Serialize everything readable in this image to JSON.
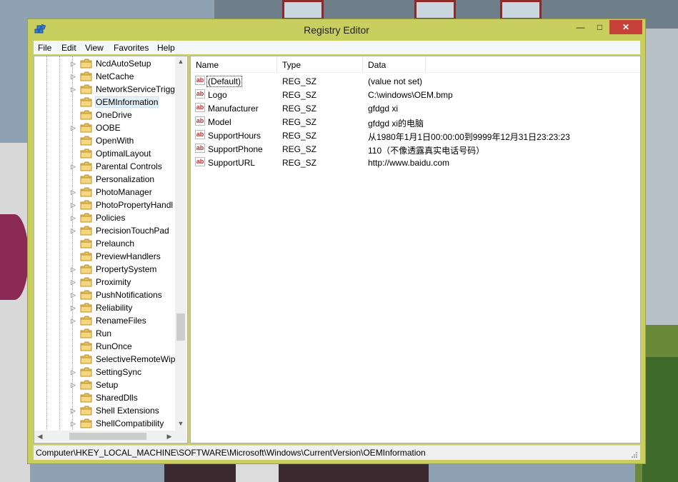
{
  "window": {
    "title": "Registry Editor",
    "minimize": "—",
    "maximize": "□",
    "close": "✕"
  },
  "menu": [
    "File",
    "Edit",
    "View",
    "Favorites",
    "Help"
  ],
  "tree": {
    "items": [
      {
        "label": "NcdAutoSetup",
        "expandable": true
      },
      {
        "label": "NetCache",
        "expandable": true
      },
      {
        "label": "NetworkServiceTrigg",
        "expandable": true
      },
      {
        "label": "OEMInformation",
        "expandable": false,
        "selected": true
      },
      {
        "label": "OneDrive",
        "expandable": false
      },
      {
        "label": "OOBE",
        "expandable": true
      },
      {
        "label": "OpenWith",
        "expandable": false
      },
      {
        "label": "OptimalLayout",
        "expandable": false
      },
      {
        "label": "Parental Controls",
        "expandable": true
      },
      {
        "label": "Personalization",
        "expandable": false
      },
      {
        "label": "PhotoManager",
        "expandable": true
      },
      {
        "label": "PhotoPropertyHandl",
        "expandable": true
      },
      {
        "label": "Policies",
        "expandable": true
      },
      {
        "label": "PrecisionTouchPad",
        "expandable": true
      },
      {
        "label": "Prelaunch",
        "expandable": false
      },
      {
        "label": "PreviewHandlers",
        "expandable": false
      },
      {
        "label": "PropertySystem",
        "expandable": true
      },
      {
        "label": "Proximity",
        "expandable": true
      },
      {
        "label": "PushNotifications",
        "expandable": true
      },
      {
        "label": "Reliability",
        "expandable": true
      },
      {
        "label": "RenameFiles",
        "expandable": true
      },
      {
        "label": "Run",
        "expandable": false
      },
      {
        "label": "RunOnce",
        "expandable": false
      },
      {
        "label": "SelectiveRemoteWipe",
        "expandable": false
      },
      {
        "label": "SettingSync",
        "expandable": true
      },
      {
        "label": "Setup",
        "expandable": true
      },
      {
        "label": "SharedDlls",
        "expandable": false
      },
      {
        "label": "Shell Extensions",
        "expandable": true
      },
      {
        "label": "ShellCompatibility",
        "expandable": true
      }
    ],
    "scroll_up": "▲",
    "scroll_down": "▼",
    "scroll_left": "◀",
    "scroll_right": "▶"
  },
  "list": {
    "columns": [
      "Name",
      "Type",
      "Data"
    ],
    "rows": [
      {
        "name": "(Default)",
        "type": "REG_SZ",
        "data": "(value not set)",
        "icon": "ab"
      },
      {
        "name": "Logo",
        "type": "REG_SZ",
        "data": "C:\\windows\\OEM.bmp",
        "icon": "ab"
      },
      {
        "name": "Manufacturer",
        "type": "REG_SZ",
        "data": "gfdgd xi",
        "icon": "ab"
      },
      {
        "name": "Model",
        "type": "REG_SZ",
        "data": "gfdgd xi的电脑",
        "icon": "ab"
      },
      {
        "name": "SupportHours",
        "type": "REG_SZ",
        "data": "从1980年1月1日00:00:00到9999年12月31日23:23:23",
        "icon": "ab"
      },
      {
        "name": "SupportPhone",
        "type": "REG_SZ",
        "data": "110（不像透露真实电话号码）",
        "icon": "ab"
      },
      {
        "name": "SupportURL",
        "type": "REG_SZ",
        "data": "http://www.baidu.com",
        "icon": "ab"
      }
    ]
  },
  "status": {
    "path": "Computer\\HKEY_LOCAL_MACHINE\\SOFTWARE\\Microsoft\\Windows\\CurrentVersion\\OEMInformation"
  },
  "colors": {
    "frame": "#c9cf5e",
    "close_button": "#c7403a",
    "selection": "#e5f1fb",
    "string_icon": "#c03030",
    "folder": "#e8c15a"
  }
}
